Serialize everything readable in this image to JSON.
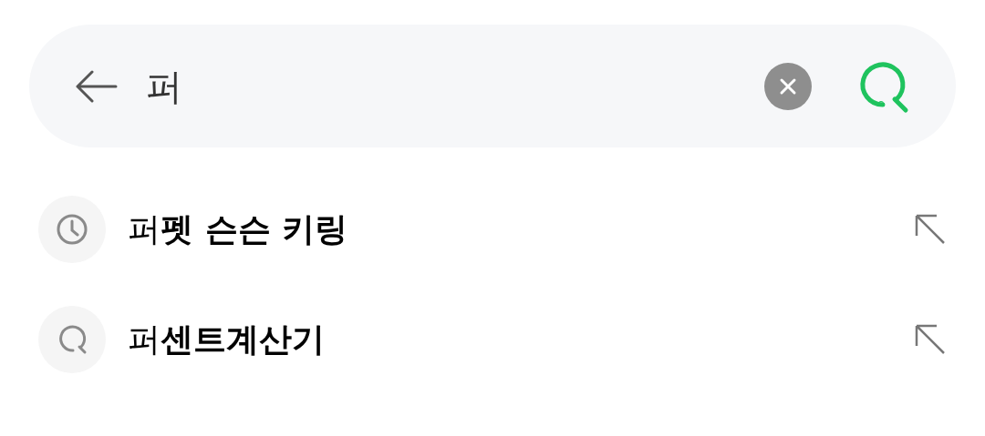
{
  "search": {
    "value": "퍼"
  },
  "suggestions": [
    {
      "kind": "history",
      "text": "퍼**펫 슨슨 키링**"
    },
    {
      "kind": "search",
      "text": "퍼**센트계산기**"
    }
  ]
}
